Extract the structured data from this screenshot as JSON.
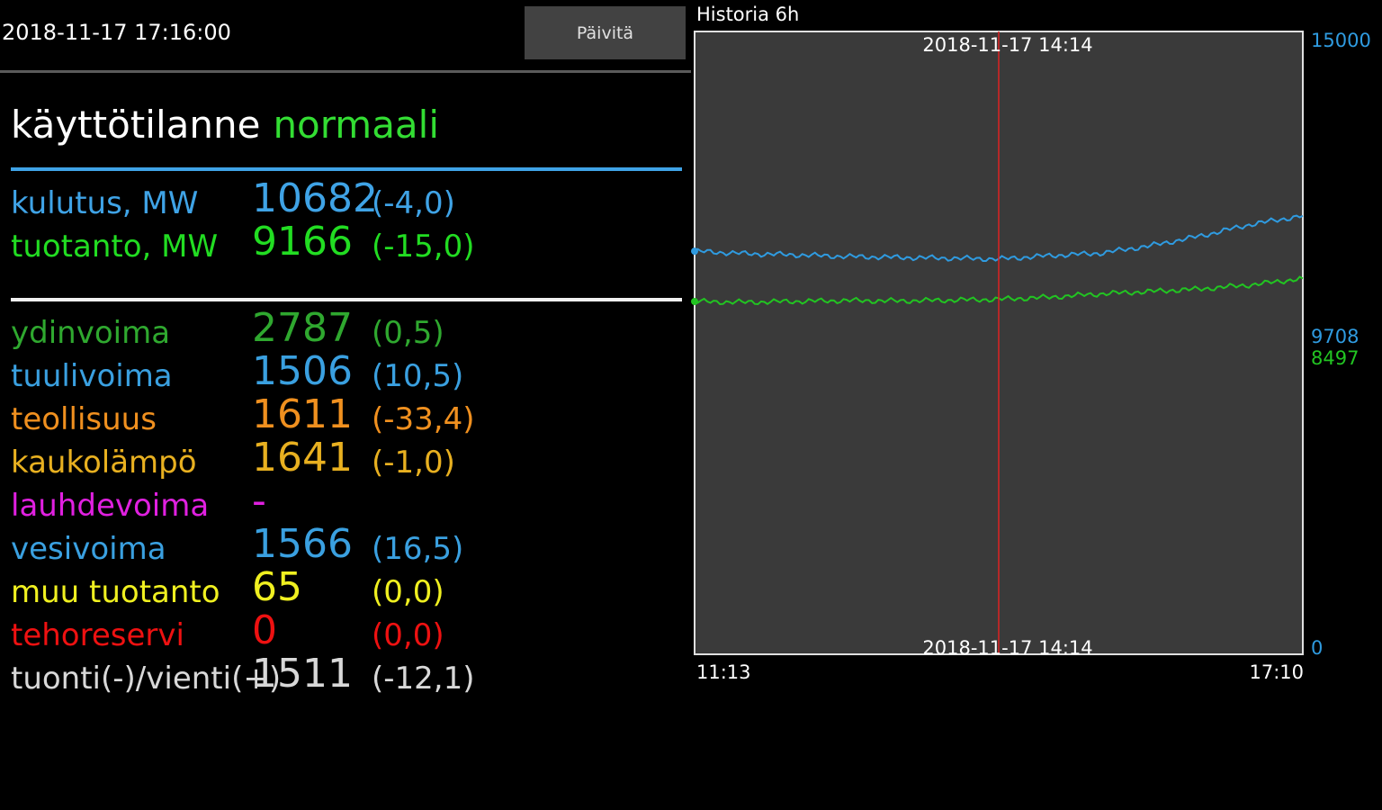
{
  "header": {
    "timestamp": "2018-11-17 17:16:00",
    "update_label": "Päivitä"
  },
  "status": {
    "label": "käyttötilanne",
    "value": "normaali"
  },
  "totals": [
    {
      "label": "kulutus, MW",
      "value": "10682",
      "change": "(-4,0)",
      "color": "#3fa3e6"
    },
    {
      "label": "tuotanto, MW",
      "value": "9166",
      "change": "(-15,0)",
      "color": "#22dd22"
    }
  ],
  "sources": [
    {
      "label": "ydinvoima",
      "value": "2787",
      "change": "(0,5)",
      "color": "#2fa82f"
    },
    {
      "label": "tuulivoima",
      "value": "1506",
      "change": "(10,5)",
      "color": "#3aa0e0"
    },
    {
      "label": "teollisuus",
      "value": "1611",
      "change": "(-33,4)",
      "color": "#f0901f"
    },
    {
      "label": "kaukolämpö",
      "value": "1641",
      "change": "(-1,0)",
      "color": "#e8b020"
    },
    {
      "label": "lauhdevoima",
      "value": "-",
      "change": "",
      "color": "#e020e0"
    },
    {
      "label": "vesivoima",
      "value": "1566",
      "change": "(16,5)",
      "color": "#3aa0e0"
    },
    {
      "label": "muu tuotanto",
      "value": "65",
      "change": "(0,0)",
      "color": "#f0f020"
    },
    {
      "label": "tehoreservi",
      "value": "0",
      "change": "(0,0)",
      "color": "#ee1111"
    },
    {
      "label": "tuonti(-)/vienti(+)",
      "value": "1511",
      "change": "(-12,1)",
      "color": "#d8d8d8"
    }
  ],
  "chart": {
    "title": "Historia 6h",
    "cursor_label": "2018-11-17 14:14",
    "x_start": "11:13",
    "x_end": "17:10",
    "y_max_label": "15000",
    "y_min_label": "0",
    "consumption_last_label": "9708",
    "production_last_label": "8497"
  },
  "chart_data": {
    "type": "line",
    "title": "Historia 6h",
    "x": [
      "11:13",
      "11:43",
      "12:13",
      "12:43",
      "13:13",
      "13:43",
      "14:14",
      "14:43",
      "15:13",
      "15:43",
      "16:13",
      "16:43",
      "17:10"
    ],
    "series": [
      {
        "name": "kulutus",
        "color": "#2f9be0",
        "values": [
          9708,
          9650,
          9620,
          9580,
          9560,
          9540,
          9520,
          9600,
          9660,
          9840,
          10080,
          10360,
          10560
        ]
      },
      {
        "name": "tuotanto",
        "color": "#22c422",
        "values": [
          8497,
          8480,
          8500,
          8520,
          8510,
          8530,
          8550,
          8600,
          8680,
          8740,
          8800,
          8900,
          9050
        ]
      }
    ],
    "ylim": [
      0,
      15000
    ],
    "cursor_x": "14:14",
    "background": "#3a3a3a",
    "grid": false
  }
}
